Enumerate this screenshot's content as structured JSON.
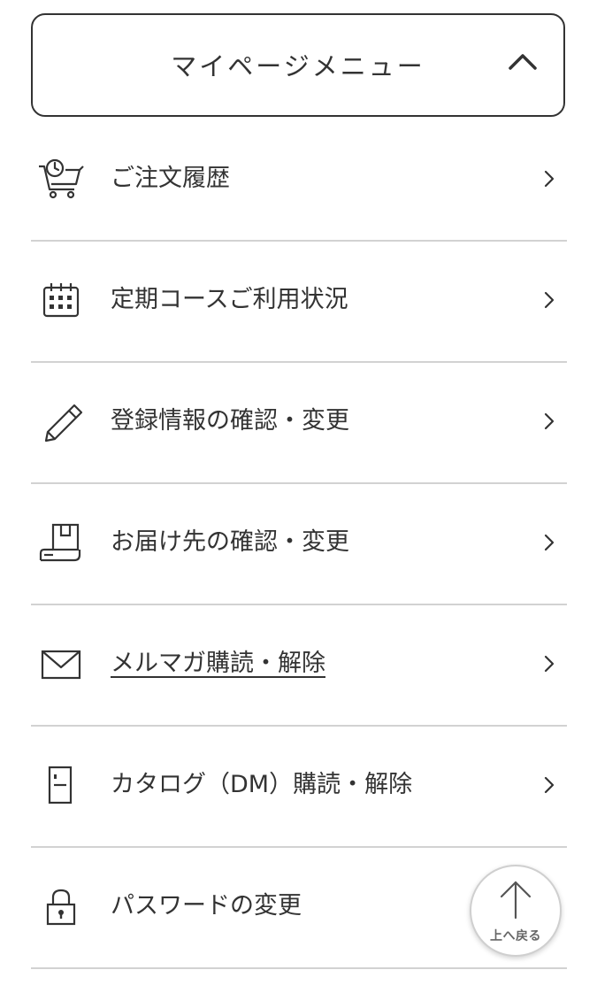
{
  "menu_header": {
    "title": "マイページメニュー",
    "chevron_icon": "chevron-up-icon"
  },
  "menu_items": [
    {
      "label": "ご注文履歴",
      "icon": "order-history-cart-icon",
      "underlined": false
    },
    {
      "label": "定期コースご利用状況",
      "icon": "calendar-icon",
      "underlined": false
    },
    {
      "label": "登録情報の確認・変更",
      "icon": "pencil-icon",
      "underlined": false
    },
    {
      "label": "お届け先の確認・変更",
      "icon": "delivery-box-icon",
      "underlined": false
    },
    {
      "label": "メルマガ購読・解除",
      "icon": "envelope-icon",
      "underlined": true
    },
    {
      "label": "カタログ（DM）購読・解除",
      "icon": "catalog-icon",
      "underlined": false
    },
    {
      "label": "パスワードの変更",
      "icon": "lock-icon",
      "underlined": false
    }
  ],
  "back_to_top": {
    "label": "上へ戻る",
    "icon": "arrow-up-icon"
  },
  "colors": {
    "text": "#333333",
    "divider": "#d2d2d2",
    "background": "#ffffff"
  }
}
